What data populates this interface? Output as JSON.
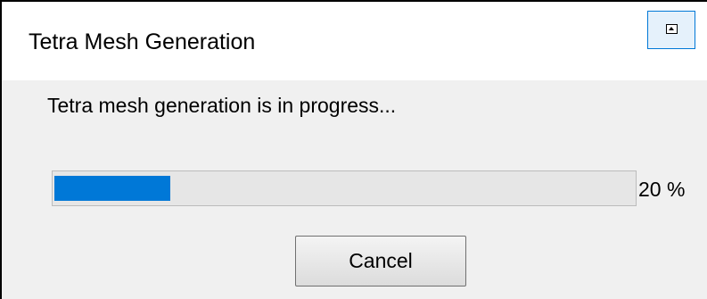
{
  "window": {
    "title": "Tetra Mesh Generation",
    "pin_icon": "restore-box-icon"
  },
  "message": "Tetra mesh generation is in progress...",
  "progress": {
    "value_percent": 20,
    "label": "20 %",
    "fill_color": "#0078d7"
  },
  "buttons": {
    "cancel_label": "Cancel"
  }
}
